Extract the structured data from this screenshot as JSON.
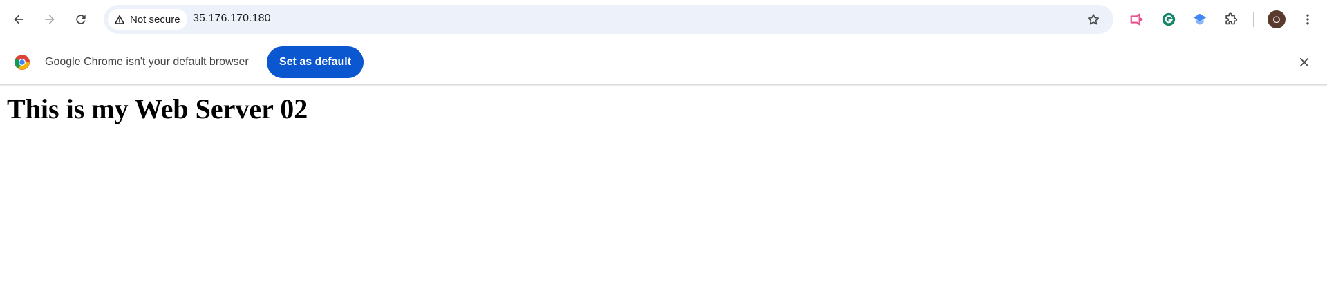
{
  "browser": {
    "nav": {
      "back_icon": "back-arrow-icon",
      "forward_icon": "forward-arrow-icon",
      "reload_icon": "reload-icon"
    },
    "omnibox": {
      "security_label": "Not secure",
      "security_icon": "warning-triangle-icon",
      "url": "35.176.170.180",
      "bookmark_icon": "star-icon"
    },
    "extensions": [
      {
        "name": "pink-arrow-extension-icon",
        "color": "#e8538f"
      },
      {
        "name": "grammarly-icon",
        "color": "#15846a"
      },
      {
        "name": "blue-cap-extension-icon",
        "color": "#4285f4"
      },
      {
        "name": "puzzle-icon",
        "color": "#444746"
      }
    ],
    "profile": {
      "initial": "O",
      "color": "#5b3a2e"
    },
    "menu_icon": "three-dot-menu-icon"
  },
  "infobar": {
    "message": "Google Chrome isn't your default browser",
    "button_label": "Set as default",
    "button_color": "#0b57d0",
    "close_icon": "close-icon"
  },
  "page": {
    "heading": "This is my Web Server 02"
  }
}
